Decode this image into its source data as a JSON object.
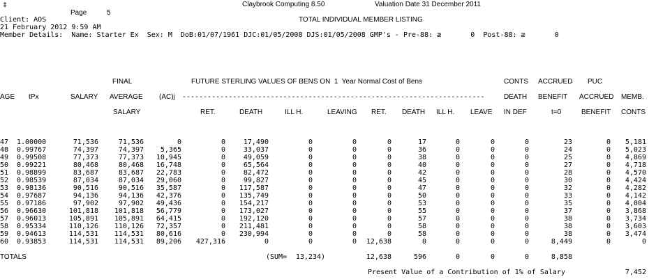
{
  "report": {
    "corner_mark": "‡",
    "software": "Claybrook Computing 8.50",
    "valuation_date": "Valuation Date 31 December 2011",
    "page_label": "Page",
    "page_number": "5",
    "client": "Client: AOS",
    "listing_title": "TOTAL INDIVIDUAL MEMBER LISTING",
    "run_datetime": "21 February 2012 9:59 AM",
    "member_details": "Member Details:  Name: Starter Ex  Sex: M  DoB:01/07/1961 DJC:01/05/2008 DJS:01/05/2008 GMP's - Pre-88: æ       0  Post-88: æ       0"
  },
  "table": {
    "header_top": {
      "final": "FINAL",
      "future": "FUTURE STERLING VALUES OF BENS ON  1  Year Normal Cost of Bens",
      "conts": "CONTS",
      "accrued": "ACCRUED",
      "puc": "PUC"
    },
    "header_mid": {
      "age": "AGE",
      "tpx": "tPx",
      "salary": "SALARY",
      "average": "AVERAGE",
      "acj": "(AC)j",
      "dashes_left": "-----------------------------------------------",
      "dashes_right": "--------------------------",
      "death": "DEATH",
      "benefit": "BENEFIT",
      "accrued": "ACCRUED",
      "memb": "MEMB."
    },
    "header_bottom": {
      "salary": "SALARY",
      "ret": "RET.",
      "death": "DEATH",
      "ill": "ILL H.",
      "leaving": "LEAVING",
      "ret2": "RET.",
      "death2": "DEATH",
      "ill2": "ILL H.",
      "leave2": "LEAVE",
      "indef": "IN DEF",
      "t0": "t=0",
      "benefit": "BENEFIT",
      "conts": "CONTS"
    },
    "rows": [
      [
        "47",
        "1.00000",
        "71,536",
        "71,536",
        "0",
        "0",
        "17,490",
        "0",
        "0",
        "0",
        "17",
        "0",
        "0",
        "0",
        "23",
        "0",
        "5,181"
      ],
      [
        "48",
        "0.99767",
        "74,397",
        "74,397",
        "5,365",
        "0",
        "33,037",
        "0",
        "0",
        "0",
        "36",
        "0",
        "0",
        "0",
        "24",
        "0",
        "5,023"
      ],
      [
        "49",
        "0.99508",
        "77,373",
        "77,373",
        "10,945",
        "0",
        "49,059",
        "0",
        "0",
        "0",
        "38",
        "0",
        "0",
        "0",
        "25",
        "0",
        "4,869"
      ],
      [
        "50",
        "0.99221",
        "80,468",
        "80,468",
        "16,748",
        "0",
        "65,564",
        "0",
        "0",
        "0",
        "40",
        "0",
        "0",
        "0",
        "27",
        "0",
        "4,718"
      ],
      [
        "51",
        "0.98899",
        "83,687",
        "83,687",
        "22,783",
        "0",
        "82,472",
        "0",
        "0",
        "0",
        "42",
        "0",
        "0",
        "0",
        "28",
        "0",
        "4,570"
      ],
      [
        "52",
        "0.98539",
        "87,034",
        "87,034",
        "29,060",
        "0",
        "99,827",
        "0",
        "0",
        "0",
        "45",
        "0",
        "0",
        "0",
        "30",
        "0",
        "4,424"
      ],
      [
        "53",
        "0.98136",
        "90,516",
        "90,516",
        "35,587",
        "0",
        "117,587",
        "0",
        "0",
        "0",
        "47",
        "0",
        "0",
        "0",
        "32",
        "0",
        "4,282"
      ],
      [
        "54",
        "0.97687",
        "94,136",
        "94,136",
        "42,376",
        "0",
        "135,749",
        "0",
        "0",
        "0",
        "50",
        "0",
        "0",
        "0",
        "33",
        "0",
        "4,142"
      ],
      [
        "55",
        "0.97186",
        "97,902",
        "97,902",
        "49,436",
        "0",
        "154,217",
        "0",
        "0",
        "0",
        "53",
        "0",
        "0",
        "0",
        "35",
        "0",
        "4,004"
      ],
      [
        "56",
        "0.96630",
        "101,818",
        "101,818",
        "56,779",
        "0",
        "173,027",
        "0",
        "0",
        "0",
        "55",
        "0",
        "0",
        "0",
        "37",
        "0",
        "3,868"
      ],
      [
        "57",
        "0.96013",
        "105,891",
        "105,891",
        "64,415",
        "0",
        "192,120",
        "0",
        "0",
        "0",
        "57",
        "0",
        "0",
        "0",
        "38",
        "0",
        "3,734"
      ],
      [
        "58",
        "0.95334",
        "110,126",
        "110,126",
        "72,357",
        "0",
        "211,481",
        "0",
        "0",
        "0",
        "58",
        "0",
        "0",
        "0",
        "38",
        "0",
        "3,603"
      ],
      [
        "59",
        "0.94613",
        "114,531",
        "114,531",
        "80,616",
        "0",
        "230,994",
        "0",
        "0",
        "0",
        "58",
        "0",
        "0",
        "0",
        "38",
        "0",
        "3,474"
      ],
      [
        "60",
        "0.93853",
        "114,531",
        "114,531",
        "89,206",
        "427,316",
        "0",
        "0",
        "0",
        "12,638",
        "0",
        "0",
        "0",
        "0",
        "8,449",
        "0",
        "0"
      ]
    ],
    "totals": {
      "label": "TOTALS",
      "sum_label": "(SUM=",
      "sum_value": "13,234)",
      "ret2": "12,638",
      "death2": "596",
      "ill2": "0",
      "leave2": "0",
      "indef": "0",
      "t0": "8,858"
    },
    "present_value_label": "Present Value of a Contribution of 1% of Salary",
    "present_value": "7,452"
  }
}
